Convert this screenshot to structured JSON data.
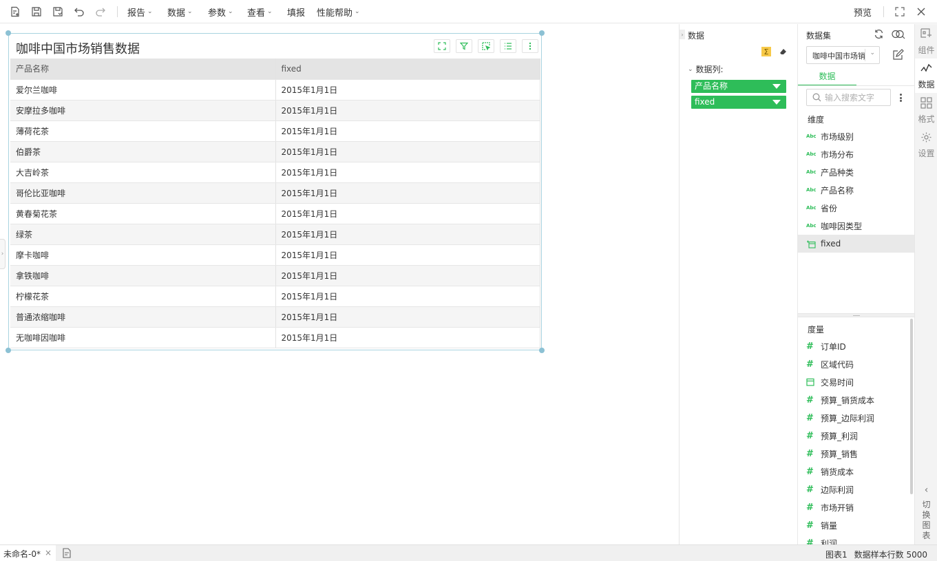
{
  "toolbar": {
    "menus": [
      "报告",
      "数据",
      "参数",
      "查看",
      "填报",
      "性能帮助"
    ],
    "preview_label": "预览",
    "icons": [
      "new-report-icon",
      "save-icon",
      "save-as-icon",
      "undo-icon",
      "redo-icon",
      "fullscreen-icon",
      "close-icon"
    ]
  },
  "widget": {
    "title": "咖啡中国市场销售数据",
    "tool_icons": [
      "expand-icon",
      "filter-icon",
      "select-icon",
      "list-icon",
      "more-icon"
    ],
    "table": {
      "headers": [
        "产品名称",
        "fixed"
      ],
      "rows": [
        [
          "爱尔兰咖啡",
          "2015年1月1日"
        ],
        [
          "安摩拉多咖啡",
          "2015年1月1日"
        ],
        [
          "薄荷花茶",
          "2015年1月1日"
        ],
        [
          "伯爵茶",
          "2015年1月1日"
        ],
        [
          "大吉岭茶",
          "2015年1月1日"
        ],
        [
          "哥伦比亚咖啡",
          "2015年1月1日"
        ],
        [
          "黄春菊花茶",
          "2015年1月1日"
        ],
        [
          "绿茶",
          "2015年1月1日"
        ],
        [
          "摩卡咖啡",
          "2015年1月1日"
        ],
        [
          "拿铁咖啡",
          "2015年1月1日"
        ],
        [
          "柠檬花茶",
          "2015年1月1日"
        ],
        [
          "普通浓缩咖啡",
          "2015年1月1日"
        ],
        [
          "无咖啡因咖啡",
          "2015年1月1日"
        ]
      ]
    }
  },
  "data_panel": {
    "title": "数据",
    "sigma": "Σ",
    "columns_label": "数据列:",
    "pills": [
      "产品名称",
      "fixed"
    ]
  },
  "dataset_panel": {
    "title": "数据集",
    "selected_dataset": "咖啡中国市场销",
    "tab_label": "数据",
    "search_placeholder": "输入搜索文字",
    "dimensions_label": "维度",
    "dimensions": [
      {
        "name": "市场级别",
        "icon": "Abc"
      },
      {
        "name": "市场分布",
        "icon": "Abc"
      },
      {
        "name": "产品种类",
        "icon": "Abc"
      },
      {
        "name": "产品名称",
        "icon": "Abc"
      },
      {
        "name": "省份",
        "icon": "Abc"
      },
      {
        "name": "咖啡因类型",
        "icon": "Abc"
      },
      {
        "name": "fixed",
        "icon": "calc-date-icon"
      }
    ],
    "measures_label": "度量",
    "measures": [
      {
        "name": "订单ID",
        "icon": "#"
      },
      {
        "name": "区域代码",
        "icon": "#"
      },
      {
        "name": "交易时间",
        "icon": "calendar-icon"
      },
      {
        "name": "预算_销货成本",
        "icon": "#"
      },
      {
        "name": "预算_边际利润",
        "icon": "#"
      },
      {
        "name": "预算_利润",
        "icon": "#"
      },
      {
        "name": "预算_销售",
        "icon": "#"
      },
      {
        "name": "销货成本",
        "icon": "#"
      },
      {
        "name": "边际利润",
        "icon": "#"
      },
      {
        "name": "市场开销",
        "icon": "#"
      },
      {
        "name": "销量",
        "icon": "#"
      },
      {
        "name": "利润",
        "icon": "#"
      }
    ]
  },
  "rail": {
    "items": [
      "组件",
      "数据",
      "格式",
      "设置"
    ],
    "active": "数据",
    "switch_label": "切换图表"
  },
  "statusbar": {
    "doc_tab": "未命名-0*",
    "close": "×",
    "chart_name": "图表1",
    "sample_rows": "数据样本行数 5000"
  },
  "colors": {
    "accent": "#2ebd59",
    "selection_border": "#a8d3e0"
  }
}
